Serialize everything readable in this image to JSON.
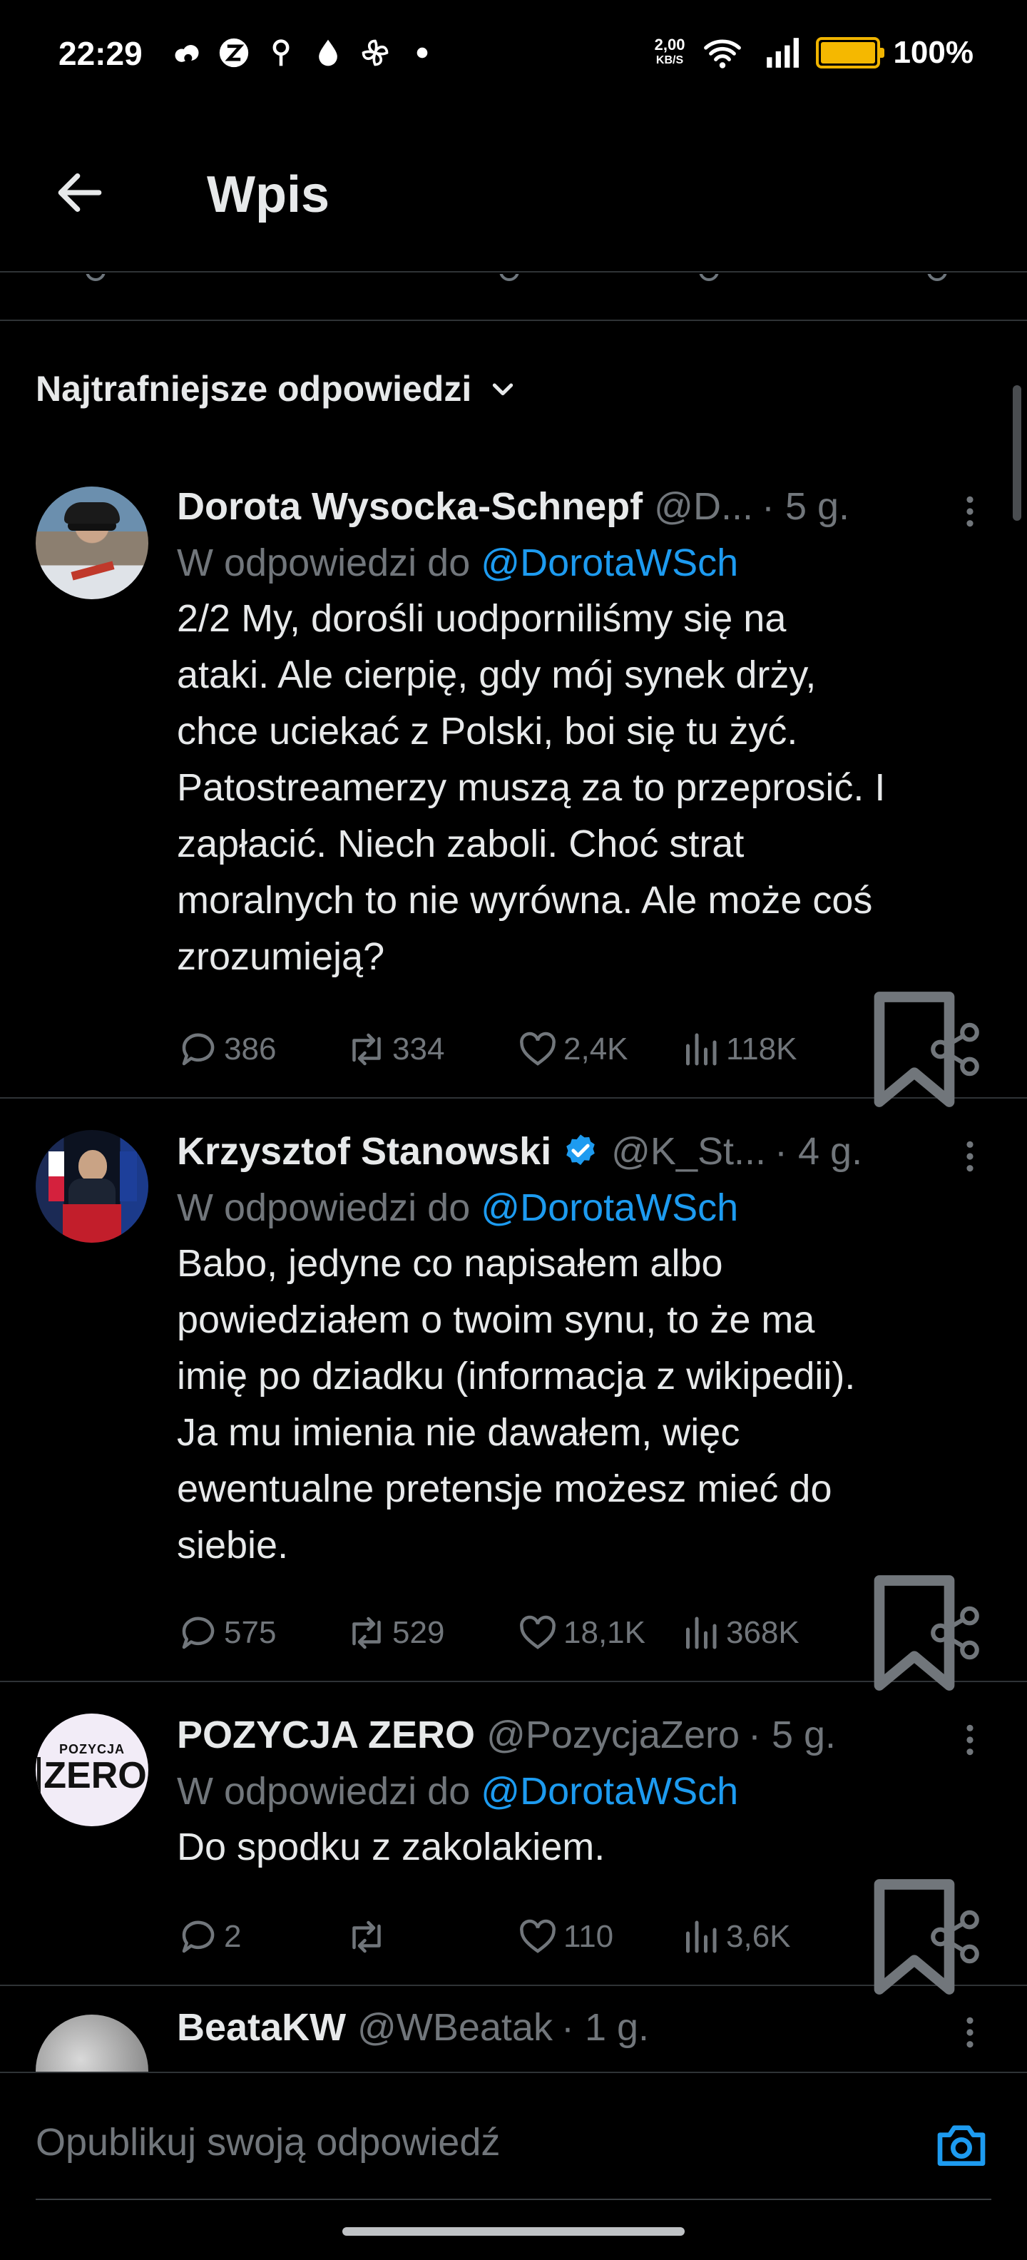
{
  "status_bar": {
    "time": "22:29",
    "speed_value": "2,00",
    "speed_unit": "KB/S",
    "battery": "100%",
    "battery_level": 1.0,
    "icons": [
      "weather-icon",
      "z-badge-icon",
      "location-icon",
      "drop-icon",
      "fan-icon",
      "dot-icon",
      "wifi-icon",
      "signal-icon",
      "battery-icon"
    ]
  },
  "header": {
    "title": "Wpis"
  },
  "sort": {
    "label": "Najtrafniejsze odpowiedzi"
  },
  "tweets": [
    {
      "name": "Dorota Wysocka-Schnepf",
      "handle": "@D...",
      "time": "· 5 g.",
      "verified": false,
      "reply_prefix": "W odpowiedzi do",
      "reply_to": "@DorotaWSch",
      "text": "2/2 My, dorośli uodporniliśmy się na\nataki. Ale cierpię, gdy mój synek drży,\nchce uciekać z Polski, boi się tu żyć.\nPatostreamerzy muszą za to przeprosić. I\nzapłacić. Niech zaboli. Choć strat\nmoralnych to nie wyrówna. Ale może coś\nzrozumieją?",
      "replies": "386",
      "retweets": "334",
      "likes": "2,4K",
      "views": "118K"
    },
    {
      "name": "Krzysztof Stanowski",
      "handle": "@K_St...",
      "time": "· 4 g.",
      "verified": true,
      "reply_prefix": "W odpowiedzi do",
      "reply_to": "@DorotaWSch",
      "text": "Babo, jedyne co napisałem albo\npowiedziałem o twoim synu, to że ma\nimię po dziadku (informacja z wikipedii).\nJa mu imienia nie dawałem, więc\newentualne pretensje możesz mieć do\nsiebie.",
      "replies": "575",
      "retweets": "529",
      "likes": "18,1K",
      "views": "368K"
    },
    {
      "name": "POZYCJA ZERO",
      "handle": "@PozycjaZero",
      "time": "· 5 g.",
      "verified": false,
      "avatar_text_top": "POZYCJA",
      "avatar_text_main": "ZERO",
      "reply_prefix": "W odpowiedzi do",
      "reply_to": "@DorotaWSch",
      "text": "Do spodku z zakolakiem.",
      "replies": "2",
      "retweets": "",
      "likes": "110",
      "views": "3,6K"
    },
    {
      "name": "BeataKW",
      "handle": "@WBeatak",
      "time": "· 1 g."
    }
  ],
  "reply_bar": {
    "placeholder": "Opublikuj swoją odpowiedź"
  },
  "colors": {
    "background": "#000000",
    "text": "#e7e9ea",
    "secondary": "#71767b",
    "accent": "#1d9bf0",
    "divider": "#2f3336",
    "battery": "#f5b800"
  }
}
